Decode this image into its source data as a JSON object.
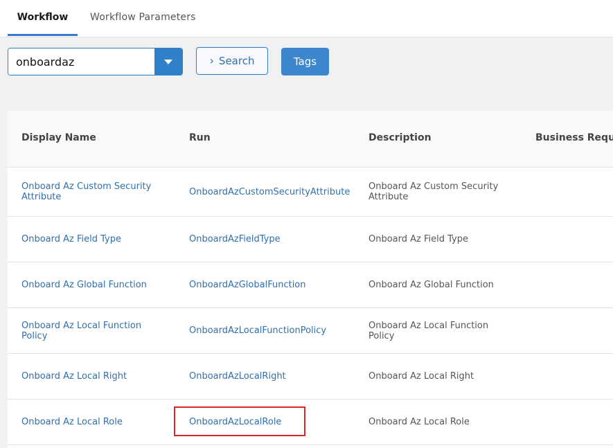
{
  "tabs": [
    {
      "label": "Workflow",
      "active": true
    },
    {
      "label": "Workflow Parameters",
      "active": false
    }
  ],
  "toolbar": {
    "search_value": "onboardaz",
    "search_button_label": "Search",
    "tags_button_label": "Tags"
  },
  "table": {
    "columns": [
      "Display Name",
      "Run",
      "Description",
      "Business Reques"
    ],
    "rows": [
      {
        "display_name": "Onboard Az Custom Security Attribute",
        "run": "OnboardAzCustomSecurityAttribute",
        "description": "Onboard Az Custom Security Attribute"
      },
      {
        "display_name": "Onboard Az Field Type",
        "run": "OnboardAzFieldType",
        "description": "Onboard Az Field Type"
      },
      {
        "display_name": "Onboard Az Global Function",
        "run": "OnboardAzGlobalFunction",
        "description": "Onboard Az Global Function"
      },
      {
        "display_name": "Onboard Az Local Function Policy",
        "run": "OnboardAzLocalFunctionPolicy",
        "description": "Onboard Az Local Function Policy"
      },
      {
        "display_name": "Onboard Az Local Right",
        "run": "OnboardAzLocalRight",
        "description": "Onboard Az Local Right"
      },
      {
        "display_name": "Onboard Az Local Role",
        "run": "OnboardAzLocalRole",
        "description": "Onboard Az Local Role"
      }
    ]
  },
  "colors": {
    "accent": "#2f80c8",
    "link": "#2f6fad",
    "highlight": "#d8262b"
  },
  "icons": {
    "dropdown": "triangle-down-icon",
    "search": "chevron-right-icon"
  }
}
